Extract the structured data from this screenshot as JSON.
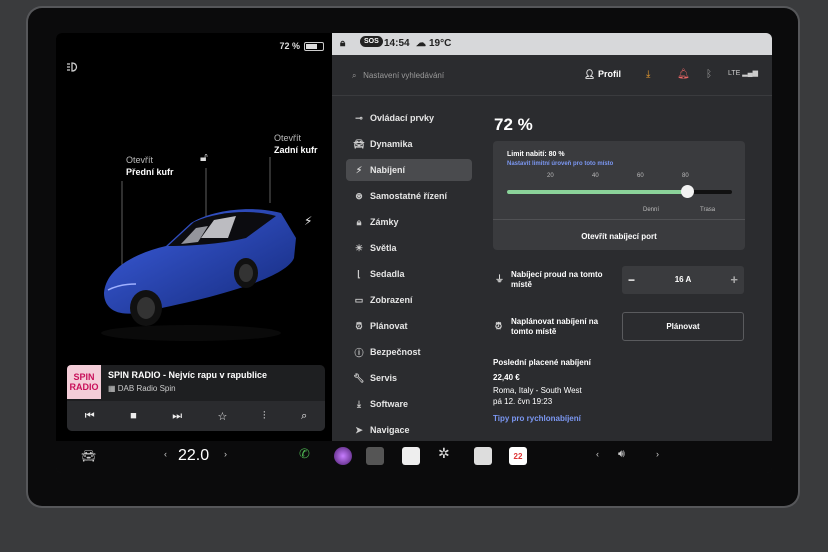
{
  "left": {
    "battery": "72 %",
    "front_trunk": {
      "top": "Otevřít",
      "bottom": "Přední kufr"
    },
    "rear_trunk": {
      "top": "Otevřít",
      "bottom": "Zadní kufr"
    }
  },
  "media": {
    "logo": "SPIN RADIO",
    "title": "SPIN RADIO - Nejvíc rapu v rapublice",
    "source": "DAB Radio Spin"
  },
  "status": {
    "sos": "SOS",
    "time": "14:54",
    "temp": "19°C"
  },
  "topbar": {
    "search_placeholder": "Nastavení vyhledávání",
    "profile": "Profil",
    "signal": "LTE"
  },
  "menu": [
    {
      "label": "Ovládací prvky",
      "icon": "toggle-icon"
    },
    {
      "label": "Dynamika",
      "icon": "car-icon"
    },
    {
      "label": "Nabíjení",
      "icon": "bolt-icon",
      "active": true
    },
    {
      "label": "Samostatné řízení",
      "icon": "steering-icon"
    },
    {
      "label": "Zámky",
      "icon": "lock-icon"
    },
    {
      "label": "Světla",
      "icon": "light-icon"
    },
    {
      "label": "Sedadla",
      "icon": "seat-icon"
    },
    {
      "label": "Zobrazení",
      "icon": "display-icon"
    },
    {
      "label": "Plánovat",
      "icon": "alarm-icon"
    },
    {
      "label": "Bezpečnost",
      "icon": "info-icon"
    },
    {
      "label": "Servis",
      "icon": "wrench-icon"
    },
    {
      "label": "Software",
      "icon": "download-icon"
    },
    {
      "label": "Navigace",
      "icon": "nav-icon"
    }
  ],
  "charging": {
    "percent": "72 %",
    "limit_label": "Limit nabití: 80 %",
    "limit_hint": "Nastavit limitní úroveň pro toto místo",
    "limit_value": 80,
    "ticks": [
      "20",
      "40",
      "60",
      "80"
    ],
    "daily": "Denní",
    "trip": "Trasa",
    "open_port": "Otevřít nabíjecí port",
    "current_label": "Nabíjecí proud na tomto místě",
    "current_value": "16  A",
    "schedule_label": "Naplánovat nabíjení na tomto místě",
    "schedule_button": "Plánovat",
    "last_header": "Poslední placené nabíjení",
    "last_amount": "22,40 €",
    "last_place": "Roma, Italy - South West",
    "last_date": "pá 12. čvn 19:23",
    "tips": "Tipy pro rychlonabíjení"
  },
  "bottom": {
    "temperature": "22.0",
    "calendar_day": "22"
  }
}
